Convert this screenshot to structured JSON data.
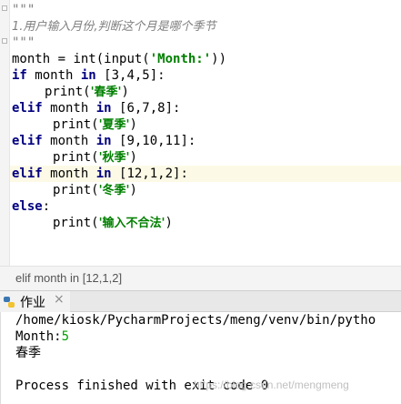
{
  "editor": {
    "docstring_open": "\"\"\"",
    "docstring_text": "1.用户输入月份,判断这个月是哪个季节",
    "docstring_close": "\"\"\"",
    "lines": {
      "l4_var": "month = ",
      "l4_call1": "int(input(",
      "l4_str": "'Month:'",
      "l4_close": "))",
      "kw_if": "if",
      "l5_rest": " month ",
      "kw_in": "in",
      "l5_list": " [3,4,5]:",
      "print": "print(",
      "str_spring": "'春季'",
      "close_paren": ")",
      "kw_elif": "elif",
      "l7_list": " [6,7,8]:",
      "str_summer": "'夏季'",
      "l9_list": " [9,10,11]:",
      "str_autumn": "'秋季'",
      "l11_list": " [12,1,2]:",
      "str_winter": "'冬季'",
      "kw_else": "else",
      "colon": ":",
      "str_invalid": "'输入不合法'"
    }
  },
  "breadcrumb": "elif month in [12,1,2]",
  "run_tab": {
    "label": "作业",
    "close": "×"
  },
  "console": {
    "command": "/home/kiosk/PycharmProjects/meng/venv/bin/pytho",
    "prompt": "Month:",
    "input_value": "5",
    "output": "春季",
    "exit_line": "Process finished with exit code 0"
  },
  "watermark": "https://blog.csdn.net/mengmeng"
}
